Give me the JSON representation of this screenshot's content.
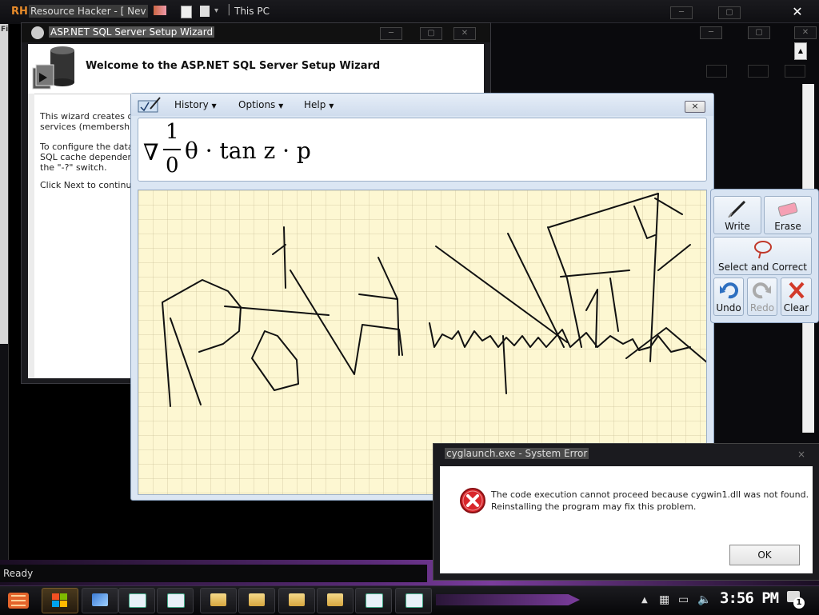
{
  "resource_hacker": {
    "logo": "RH",
    "title": "Resource Hacker - [ Nev",
    "location": "This PC",
    "status": "Ready",
    "menu_letter": "Fi"
  },
  "asp_wizard": {
    "title": "ASP.NET SQL Server Setup Wizard",
    "heading": "Welcome to the ASP.NET SQL Server Setup Wizard",
    "para1_line1": "This wizard creates or",
    "para1_line2": "services (membership",
    "para2_line1": "To configure the databa",
    "para2_line2": "SQL cache dependenc",
    "para2_line3": "the \"-?\" switch.",
    "para3": "Click Next to continue."
  },
  "math_input": {
    "menus": [
      "History",
      "Options",
      "Help"
    ],
    "close_glyph": "×",
    "preview": {
      "nabla": "∇",
      "numerator": "1",
      "denominator": "0",
      "rest": "θ · tan z · p"
    },
    "tools": {
      "write": "Write",
      "erase": "Erase",
      "select_correct": "Select and Correct",
      "undo": "Undo",
      "redo": "Redo",
      "clear": "Clear"
    }
  },
  "error_dialog": {
    "title": "cyglaunch.exe - System Error",
    "line1": "The code execution cannot proceed because cygwin1.dll was not found.",
    "line2": "Reinstalling the program may fix this problem.",
    "ok_label": "OK",
    "close_glyph": "×"
  },
  "taskbar": {
    "clock": "3:56 PM",
    "notification_count": "1"
  }
}
